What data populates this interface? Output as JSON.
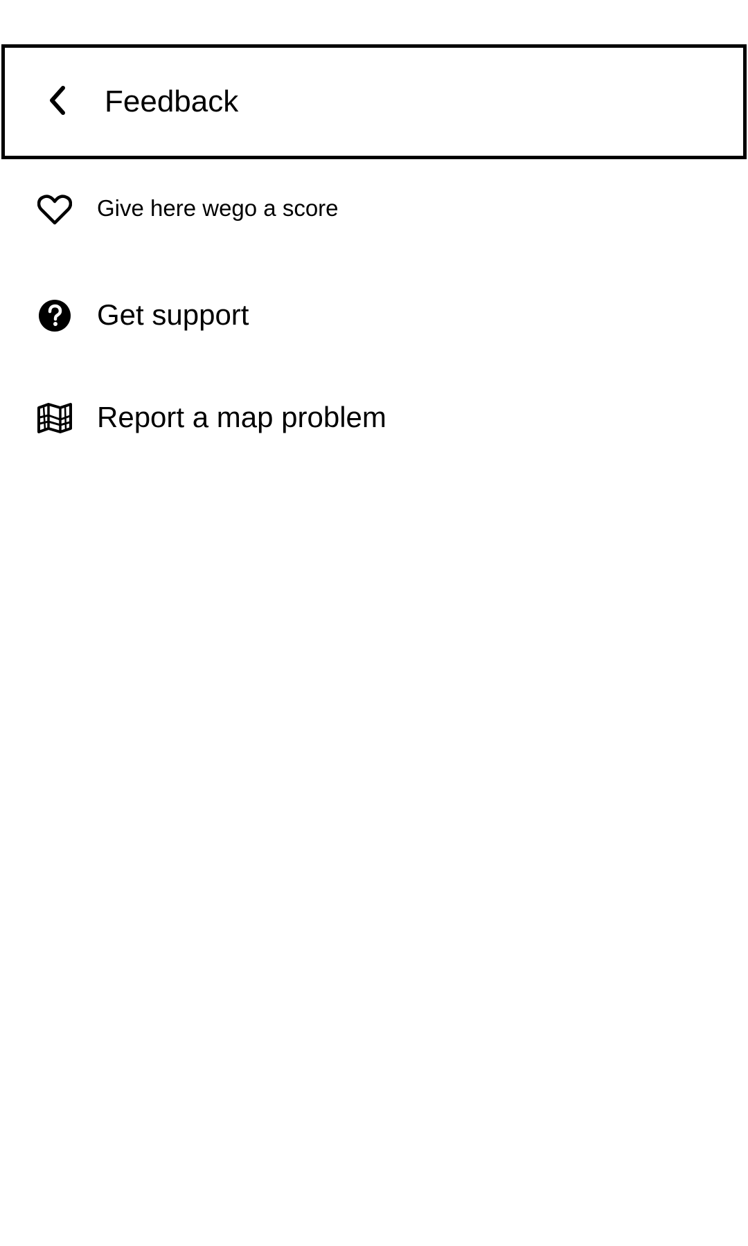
{
  "header": {
    "title": "Feedback",
    "back_icon": "chevron-left-icon"
  },
  "menu": {
    "items": [
      {
        "label": "Give here wego a score",
        "icon": "heart-outline-icon"
      },
      {
        "label": "Get support",
        "icon": "help-circle-icon"
      },
      {
        "label": "Report a map problem",
        "icon": "map-icon"
      }
    ]
  },
  "colors": {
    "background": "#ffffff",
    "foreground": "#000000"
  }
}
